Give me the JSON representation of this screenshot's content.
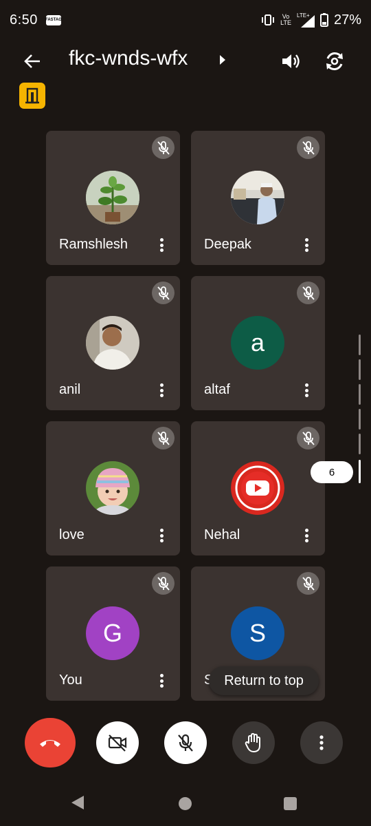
{
  "status_bar": {
    "time": "6:50",
    "app_icon_text": "FASTAG",
    "volte_top": "Vo",
    "volte_bottom": "LTE",
    "lte_label": "LTE+",
    "battery_percent": "27%"
  },
  "header": {
    "meeting_code": "fkc-wnds-wfx"
  },
  "participants": [
    {
      "name": "Ramshlesh",
      "avatar_type": "photo",
      "avatar_desc": "plant",
      "muted": true
    },
    {
      "name": "Deepak",
      "avatar_type": "photo",
      "avatar_desc": "man-in-shop",
      "muted": true
    },
    {
      "name": "anil",
      "avatar_type": "photo",
      "avatar_desc": "man-portrait",
      "muted": true
    },
    {
      "name": "altaf",
      "avatar_type": "letter",
      "letter": "a",
      "color": "#0d5c46",
      "muted": true
    },
    {
      "name": "love",
      "avatar_type": "photo",
      "avatar_desc": "baby-in-hat",
      "muted": true
    },
    {
      "name": "Nehal",
      "avatar_type": "logo",
      "avatar_desc": "youtube-logo",
      "muted": true
    },
    {
      "name": "You",
      "avatar_type": "letter",
      "letter": "G",
      "color": "#a142c4",
      "muted": true
    },
    {
      "name": "Su",
      "avatar_type": "letter",
      "letter": "S",
      "color": "#0e56a3",
      "muted": true
    }
  ],
  "page_indicator": "6",
  "return_to_top": "Return to top",
  "colors": {
    "background": "#1b1613",
    "tile": "#3b3330",
    "end_call": "#ea4335",
    "meeting_badge": "#f6b400"
  },
  "controls": [
    "end-call",
    "camera-off",
    "mic-off",
    "raise-hand",
    "more-options"
  ]
}
